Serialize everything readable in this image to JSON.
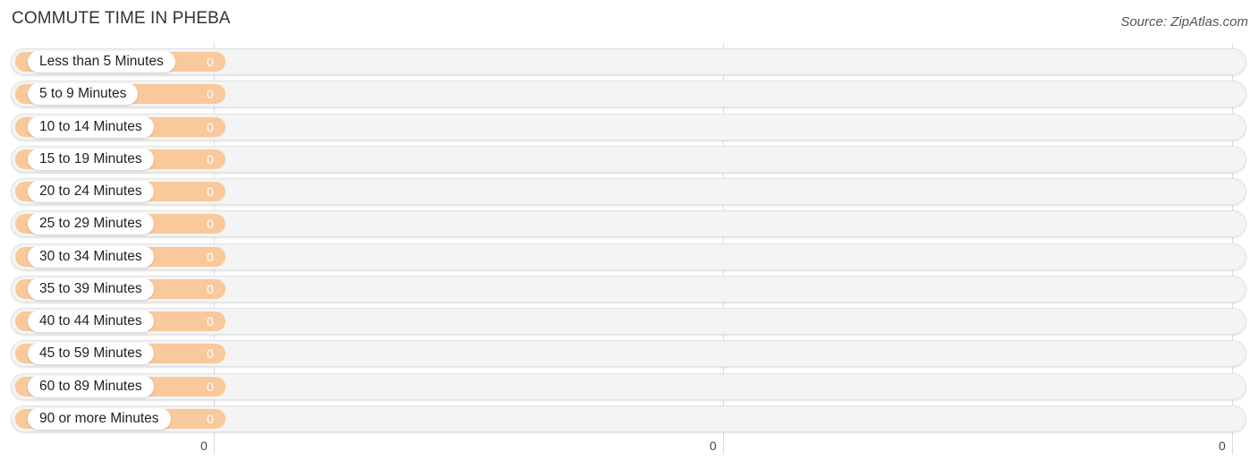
{
  "header": {
    "title": "COMMUTE TIME IN PHEBA",
    "source": "Source: ZipAtlas.com"
  },
  "chart_data": {
    "type": "bar",
    "orientation": "horizontal",
    "title": "COMMUTE TIME IN PHEBA",
    "source": "Source: ZipAtlas.com",
    "categories": [
      "Less than 5 Minutes",
      "5 to 9 Minutes",
      "10 to 14 Minutes",
      "15 to 19 Minutes",
      "20 to 24 Minutes",
      "25 to 29 Minutes",
      "30 to 34 Minutes",
      "35 to 39 Minutes",
      "40 to 44 Minutes",
      "45 to 59 Minutes",
      "60 to 89 Minutes",
      "90 or more Minutes"
    ],
    "values": [
      0,
      0,
      0,
      0,
      0,
      0,
      0,
      0,
      0,
      0,
      0,
      0
    ],
    "value_labels": [
      "0",
      "0",
      "0",
      "0",
      "0",
      "0",
      "0",
      "0",
      "0",
      "0",
      "0",
      "0"
    ],
    "x_ticks": [
      "0",
      "0",
      "0"
    ],
    "xlabel": "",
    "ylabel": "",
    "grid": true,
    "bar_color": "#f9c89b",
    "track_color": "#f4f4f4"
  }
}
